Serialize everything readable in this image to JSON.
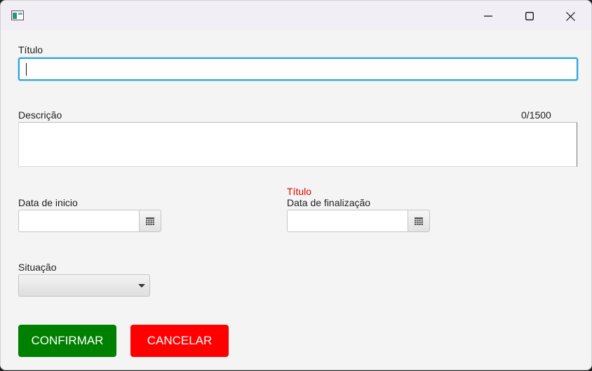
{
  "window": {
    "title": "",
    "accent_color": "#2ba3d8"
  },
  "form": {
    "titulo": {
      "label": "Título",
      "value": ""
    },
    "descricao": {
      "label": "Descrição",
      "counter": "0/1500",
      "value": ""
    },
    "data_inicio": {
      "label": "Data de inicio",
      "value": ""
    },
    "data_finalizacao": {
      "label": "Data de finalização",
      "error": "Título",
      "value": ""
    },
    "situacao": {
      "label": "Situação",
      "selected": ""
    }
  },
  "buttons": {
    "confirm": {
      "label": "CONFIRMAR",
      "color": "#008000"
    },
    "cancel": {
      "label": "CANCELAR",
      "color": "#ff0000"
    }
  },
  "colors": {
    "error_text": "#e00000"
  },
  "icons": [
    "app-icon",
    "minimize-icon",
    "maximize-icon",
    "close-icon",
    "calendar-icon",
    "dropdown-arrow-icon"
  ]
}
